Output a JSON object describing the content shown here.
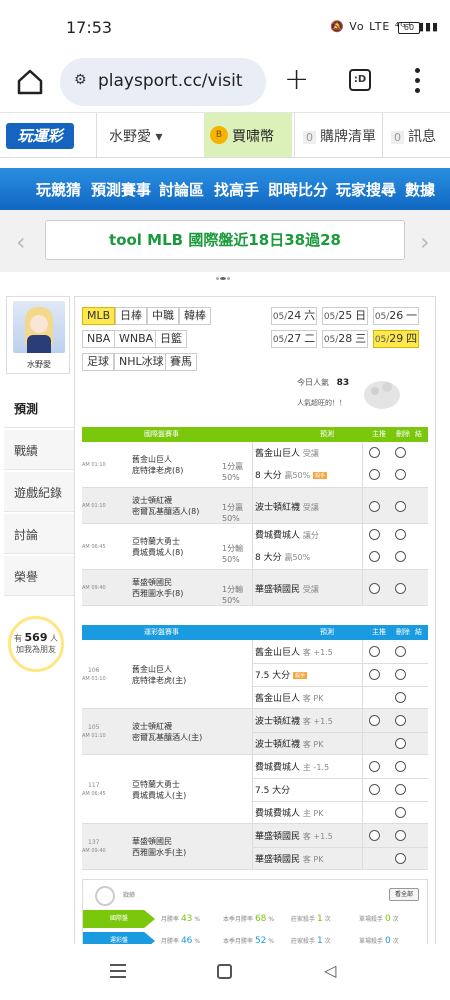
{
  "status": {
    "time": "17:53",
    "icons": "🔕 Vo LTE ⁴ᴳ⁺ ▮▮▮",
    "battery": "60"
  },
  "browser": {
    "url": "playsport.cc/visit",
    "tabs": ":D"
  },
  "header": {
    "logo": "玩運彩",
    "user": "水野愛 ▾",
    "buy": "買啸幣",
    "coin": "B",
    "cart": "購牌清單",
    "cart_count": "0",
    "msg": "訊息",
    "msg_count": "0"
  },
  "nav": [
    "玩競猜",
    "預測賽事",
    "討論區",
    "找高手",
    "即時比分",
    "玩家搜尋",
    "數據"
  ],
  "banner": {
    "text": "tool MLB 國際盤近18日38過28",
    "left": "‹",
    "right": "›"
  },
  "sidebar": {
    "username": "水野愛",
    "items": [
      "預測",
      "戰績",
      "遊戲紀錄",
      "討論",
      "榮譽"
    ],
    "bulb_prefix": "有",
    "bulb_count": "569",
    "bulb_suffix": "人",
    "bulb_line2": "加我為朋友"
  },
  "leagues": {
    "row1": [
      "MLB",
      "日棒",
      "中職",
      "韓棒"
    ],
    "row2": [
      "NBA",
      "WNBA",
      "日籃"
    ],
    "row3": [
      "足球",
      "NHL冰球",
      "賽馬"
    ]
  },
  "dates": [
    {
      "d": "05/",
      "n": "24",
      "w": "六"
    },
    {
      "d": "05/",
      "n": "25",
      "w": "日"
    },
    {
      "d": "05/",
      "n": "26",
      "w": "一"
    },
    {
      "d": "05/",
      "n": "27",
      "w": "二"
    },
    {
      "d": "05/",
      "n": "28",
      "w": "三"
    },
    {
      "d": "05/",
      "n": "29",
      "w": "四"
    }
  ],
  "popularity": {
    "label": "今日人氣",
    "value": "83",
    "label2": "人氣超旺的！！"
  },
  "intl": {
    "h_game": "國際盤賽事",
    "h_pred": "預測",
    "h_home": "主推",
    "h_del": "刪除",
    "h_res": "結果",
    "rows": [
      {
        "time": "AM 01:10",
        "t1": "舊金山巨人",
        "t2": "底特律老虎(8)",
        "o1": "1分贏",
        "o2": "50%",
        "p1": "舊金山巨人",
        "p1s": "受讓",
        "p2": "8 大分",
        "p2s": "贏50%",
        "hot": "殺手"
      },
      {
        "time": "AM 01:10",
        "t1": "波士頓紅襪",
        "t2": "密爾瓦基釀酒人(8)",
        "o1": "1分贏",
        "o2": "50%",
        "p1": "波士頓紅襪",
        "p1s": "受讓"
      },
      {
        "time": "AM 06:45",
        "t1": "亞特蘭大勇士",
        "t2": "費城費城人(8)",
        "o1": "1分輸",
        "o2": "50%",
        "p1": "費城費城人",
        "p1s": "讓分",
        "p2": "8 大分",
        "p2s": "贏50%"
      },
      {
        "time": "AM 09:40",
        "t1": "華盛頓國民",
        "t2": "西雅圖水手(8)",
        "o1": "1分輸",
        "o2": "50%",
        "p1": "華盛頓國民",
        "p1s": "受讓"
      }
    ]
  },
  "local": {
    "h_game": "運彩盤賽事",
    "h_pred": "預測",
    "h_home": "主推",
    "h_del": "刪除",
    "h_res": "結果",
    "rows": [
      {
        "num": "106",
        "time": "AM 01:10",
        "t1": "舊金山巨人",
        "t2": "底特律老虎(主)",
        "picks": [
          {
            "p": "舊金山巨人",
            "s": "客 +1.5"
          },
          {
            "p": "7.5 大分",
            "s": "",
            "hot": "殺手"
          },
          {
            "p": "舊金山巨人",
            "s": "客 PK"
          }
        ]
      },
      {
        "num": "105",
        "time": "AM 01:10",
        "t1": "波士頓紅襪",
        "t2": "密爾瓦基釀酒人(主)",
        "picks": [
          {
            "p": "波士頓紅襪",
            "s": "客 +1.5"
          },
          {
            "p": "波士頓紅襪",
            "s": "客 PK"
          }
        ]
      },
      {
        "num": "117",
        "time": "AM 06:45",
        "t1": "亞特蘭大勇士",
        "t2": "費城費城人(主)",
        "picks": [
          {
            "p": "費城費城人",
            "s": "主 -1.5"
          },
          {
            "p": "7.5 大分",
            "s": ""
          },
          {
            "p": "費城費城人",
            "s": "主 PK"
          }
        ]
      },
      {
        "num": "137",
        "time": "AM 09:40",
        "t1": "華盛頓國民",
        "t2": "西雅圖水手(主)",
        "picks": [
          {
            "p": "華盛頓國民",
            "s": "客 +1.5"
          },
          {
            "p": "華盛頓國民",
            "s": "客 PK"
          }
        ]
      }
    ]
  },
  "stats": {
    "label": "戰績",
    "more": "看全部",
    "rows": [
      {
        "tag": "國際盤",
        "color": "#7ac70c",
        "a": "月勝率",
        "av": "43",
        "au": "%",
        "b": "本季月勝率",
        "bv": "68",
        "bu": "%",
        "c": "莊家殺手",
        "cv": "1",
        "cu": "次",
        "d": "單場殺手",
        "dv": "0",
        "du": "次"
      },
      {
        "tag": "運彩盤",
        "color": "#1a9be0",
        "a": "月勝率",
        "av": "46",
        "au": "%",
        "b": "本季月勝率",
        "bv": "52",
        "bu": "%",
        "c": "莊家殺手",
        "cv": "1",
        "cu": "次",
        "d": "單場殺手",
        "dv": "0",
        "du": "次"
      }
    ]
  }
}
